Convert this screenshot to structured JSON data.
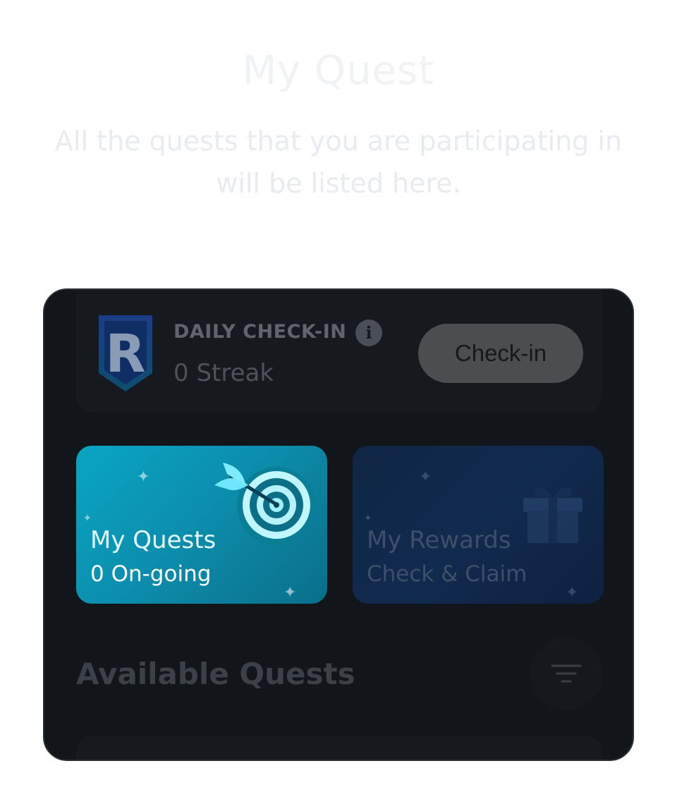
{
  "header": {
    "title": "My Quest",
    "subtitle": "All the quests that you are participating in will be listed here."
  },
  "checkin": {
    "title": "DAILY CHECK-IN",
    "info_icon": "i",
    "streak": "0 Streak",
    "button_label": "Check-in",
    "logo_letter": "R"
  },
  "tiles": {
    "quests": {
      "label": "My Quests",
      "sub": "0 On-going"
    },
    "rewards": {
      "label": "My Rewards",
      "sub": "Check & Claim"
    }
  },
  "available": {
    "title": "Available Quests"
  },
  "icons": {
    "shield": "shield-logo-icon",
    "info": "info-icon",
    "target": "target-dart-icon",
    "gift": "gift-icon",
    "filter": "filter-icon"
  },
  "colors": {
    "quests_tile": "#08a6c4",
    "rewards_tile": "#112a4f",
    "card_bg": "#121519"
  }
}
